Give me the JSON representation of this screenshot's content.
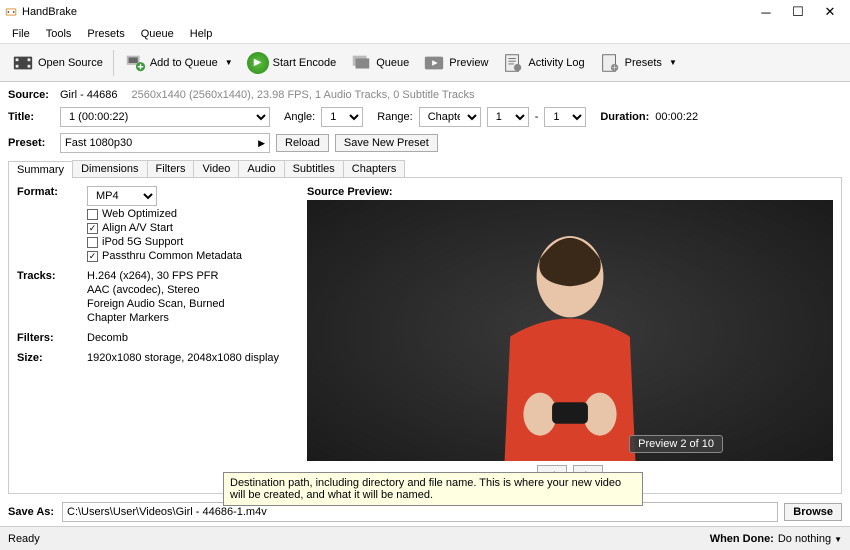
{
  "window": {
    "title": "HandBrake"
  },
  "menu": {
    "file": "File",
    "tools": "Tools",
    "presets": "Presets",
    "queue": "Queue",
    "help": "Help"
  },
  "toolbar": {
    "open_source": "Open Source",
    "add_to_queue": "Add to Queue",
    "start_encode": "Start Encode",
    "queue": "Queue",
    "preview": "Preview",
    "activity_log": "Activity Log",
    "presets": "Presets"
  },
  "source": {
    "label": "Source:",
    "name": "Girl - 44686",
    "info": "2560x1440 (2560x1440), 23.98 FPS, 1 Audio Tracks, 0 Subtitle Tracks"
  },
  "title": {
    "label": "Title:",
    "value": "1  (00:00:22)",
    "angle_label": "Angle:",
    "angle_value": "1",
    "range_label": "Range:",
    "range_kind": "Chapters",
    "range_from": "1",
    "range_sep": "-",
    "range_to": "1",
    "duration_label": "Duration:",
    "duration_value": "00:00:22"
  },
  "preset": {
    "label": "Preset:",
    "value": "Fast 1080p30",
    "reload": "Reload",
    "save_new": "Save New Preset"
  },
  "tabs": {
    "summary": "Summary",
    "dimensions": "Dimensions",
    "filters": "Filters",
    "video": "Video",
    "audio": "Audio",
    "subtitles": "Subtitles",
    "chapters": "Chapters"
  },
  "summary": {
    "format_label": "Format:",
    "format_value": "MP4",
    "web_optimized": "Web Optimized",
    "align_av": "Align A/V Start",
    "ipod": "iPod 5G Support",
    "passthru": "Passthru Common Metadata",
    "tracks_label": "Tracks:",
    "track_video": "H.264 (x264), 30 FPS PFR",
    "track_audio": "AAC (avcodec), Stereo",
    "track_foreign": "Foreign Audio Scan, Burned",
    "track_chapters": "Chapter Markers",
    "filters_label": "Filters:",
    "filters_value": "Decomb",
    "size_label": "Size:",
    "size_value": "1920x1080 storage, 2048x1080 display"
  },
  "preview": {
    "label": "Source Preview:",
    "badge": "Preview 2 of 10",
    "prev": "<",
    "next": ">"
  },
  "saveas": {
    "label": "Save As:",
    "value": "C:\\Users\\User\\Videos\\Girl - 44686-1.m4v",
    "browse": "Browse"
  },
  "tooltip": "Destination path, including directory and file name. This is where your new video will be created, and what it will be named.",
  "status": {
    "ready": "Ready",
    "when_done_label": "When Done:",
    "when_done_value": "Do nothing"
  }
}
